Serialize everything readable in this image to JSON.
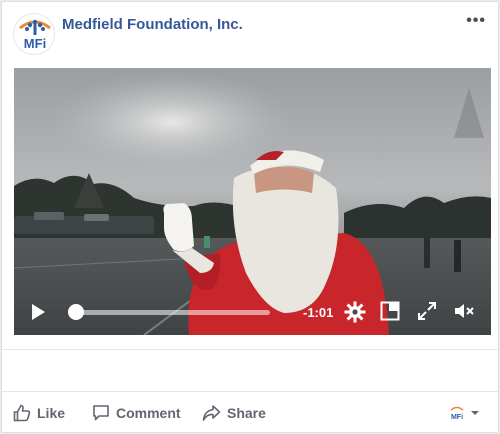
{
  "post": {
    "page_name": "Medfield Foundation, Inc.",
    "logo_text": "MFi",
    "more_label": "•••"
  },
  "video": {
    "time_remaining": "-1:01",
    "progress": 0.03
  },
  "actions": {
    "like": "Like",
    "comment": "Comment",
    "share": "Share"
  },
  "colors": {
    "page_name": "#365899",
    "action_text": "#606770",
    "logo_blue": "#2d5fa8",
    "logo_orange": "#e98a2f"
  }
}
